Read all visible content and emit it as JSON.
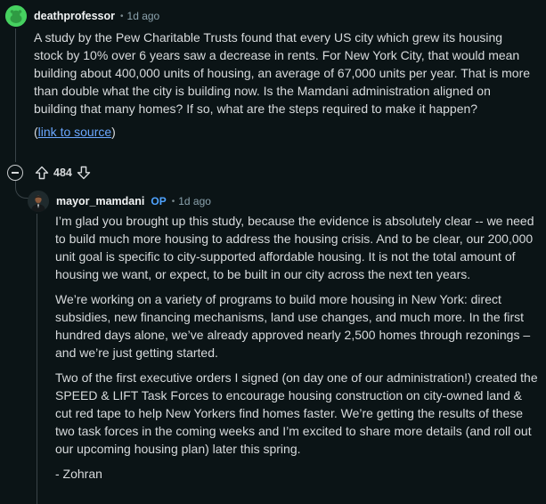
{
  "parent_comment": {
    "username": "deathprofessor",
    "separator": "•",
    "time": "1d ago",
    "paragraph": "A study by the Pew Charitable Trusts found that every US city which grew its housing stock by 10% over 6 years saw a decrease in rents. For New York City, that would mean building about 400,000 units of housing, an average of 67,000 units per year. That is more than double what the city is building now. Is the Mamdani administration aligned on building that many homes? If so, what are the steps required to make it happen?",
    "link_open": "(",
    "link_text": "link to source",
    "link_close": ")",
    "votes": "484",
    "avatar_icon": "snoo-avatar-icon",
    "colors": {
      "avatar": "#46d160",
      "link": "#6ba7ff"
    }
  },
  "reply_comment": {
    "username": "mayor_mamdani",
    "op_badge": "OP",
    "separator": "•",
    "time": "1d ago",
    "paragraphs": [
      "I’m glad you brought up this study, because the evidence is absolutely clear -- we need to build much more housing to address the housing crisis. And to be clear, our 200,000 unit goal is specific to city-supported affordable housing. It is not the total amount of housing we want, or expect, to be built in our city across the next ten years.",
      "We’re working on a variety of programs to build more housing in New York: direct subsidies, new financing mechanisms, land use changes, and much more. In the first hundred days alone, we’ve already approved nearly 2,500 homes through rezonings – and we’re just getting started.",
      "Two of the first executive orders I signed (on day one of our administration!) created the SPEED & LIFT Task Forces to encourage housing construction on city-owned land & cut red tape to help New Yorkers find homes faster. We’re getting the results of these two task forces in the coming weeks and I’m excited to share more details (and roll out our upcoming housing plan) later this spring.",
      "- Zohran"
    ],
    "colors": {
      "op_badge": "#4fa3ff"
    }
  }
}
